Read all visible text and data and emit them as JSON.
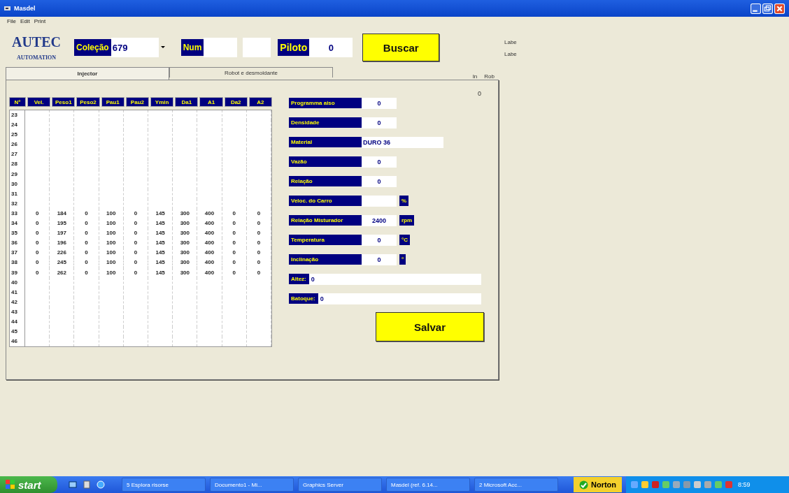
{
  "window": {
    "title": "Masdel"
  },
  "menu": [
    "File",
    "Edit",
    "Print"
  ],
  "logo": {
    "title": "AUTEC",
    "subtitle": "AUTOMATION"
  },
  "toolbar": {
    "colecao_label": "Coleção",
    "colecao_value": "679",
    "num_label": "Num",
    "piloto_label": "Piloto",
    "piloto_value": "0",
    "search_button": "Buscar"
  },
  "side_labels": [
    "Labe",
    "Labe"
  ],
  "tabs": [
    {
      "label": "Injector",
      "selected": true
    },
    {
      "label": "Robot e desmoldante",
      "selected": false
    }
  ],
  "tab_side_labels": [
    "In",
    "Rob"
  ],
  "panel_counter": "0",
  "table": {
    "columns": [
      "N°",
      "Vel.",
      "Peso1",
      "Peso2",
      "Pau1",
      "Pau2",
      "Ymin",
      "Da1",
      "A1",
      "Da2",
      "A2"
    ],
    "rows": [
      [
        "23"
      ],
      [
        "24"
      ],
      [
        "25"
      ],
      [
        "26"
      ],
      [
        "27"
      ],
      [
        "28"
      ],
      [
        "29"
      ],
      [
        "30"
      ],
      [
        "31"
      ],
      [
        "32"
      ],
      [
        "33",
        "0",
        "184",
        "0",
        "100",
        "0",
        "145",
        "300",
        "400",
        "0",
        "0"
      ],
      [
        "34",
        "0",
        "195",
        "0",
        "100",
        "0",
        "145",
        "300",
        "400",
        "0",
        "0"
      ],
      [
        "35",
        "0",
        "197",
        "0",
        "100",
        "0",
        "145",
        "300",
        "400",
        "0",
        "0"
      ],
      [
        "36",
        "0",
        "196",
        "0",
        "100",
        "0",
        "145",
        "300",
        "400",
        "0",
        "0"
      ],
      [
        "37",
        "0",
        "226",
        "0",
        "100",
        "0",
        "145",
        "300",
        "400",
        "0",
        "0"
      ],
      [
        "38",
        "0",
        "245",
        "0",
        "100",
        "0",
        "145",
        "300",
        "400",
        "0",
        "0"
      ],
      [
        "39",
        "0",
        "262",
        "0",
        "100",
        "0",
        "145",
        "300",
        "400",
        "0",
        "0"
      ],
      [
        "40"
      ],
      [
        "41"
      ],
      [
        "42"
      ],
      [
        "43"
      ],
      [
        "44"
      ],
      [
        "45"
      ],
      [
        "46"
      ]
    ]
  },
  "fields": [
    {
      "kind": "short",
      "label": "Programma aiso",
      "value": "0"
    },
    {
      "kind": "short",
      "label": "Densidade",
      "value": "0"
    },
    {
      "kind": "long",
      "label": "Material",
      "value": "DURO 36"
    },
    {
      "kind": "short",
      "label": "Vazão",
      "value": "0"
    },
    {
      "kind": "short",
      "label": "Relação",
      "value": "0"
    },
    {
      "kind": "short",
      "label": "Veloc. do Carro",
      "unit": "%"
    },
    {
      "kind": "short",
      "label": "Relação Misturador",
      "value": "2400",
      "unit": "rpm"
    },
    {
      "kind": "short",
      "label": "Temperatura",
      "value": "0",
      "unit": "°C"
    },
    {
      "kind": "short",
      "label": "Inclinação",
      "value": "0",
      "unit": "°"
    },
    {
      "kind": "wide",
      "label": "Altez:",
      "value": "0"
    },
    {
      "kind": "wide",
      "label": "Batoque:",
      "value": "0"
    }
  ],
  "save_button": "Salvar",
  "taskbar": {
    "start": "start",
    "tasks": [
      "5 Esplora risorse",
      "Documento1 - Mi...",
      "Graphics Server",
      "Masdel (ref. 6.14...",
      "2 Microsoft Acc..."
    ],
    "norton": "Norton",
    "clock": "8:59"
  }
}
